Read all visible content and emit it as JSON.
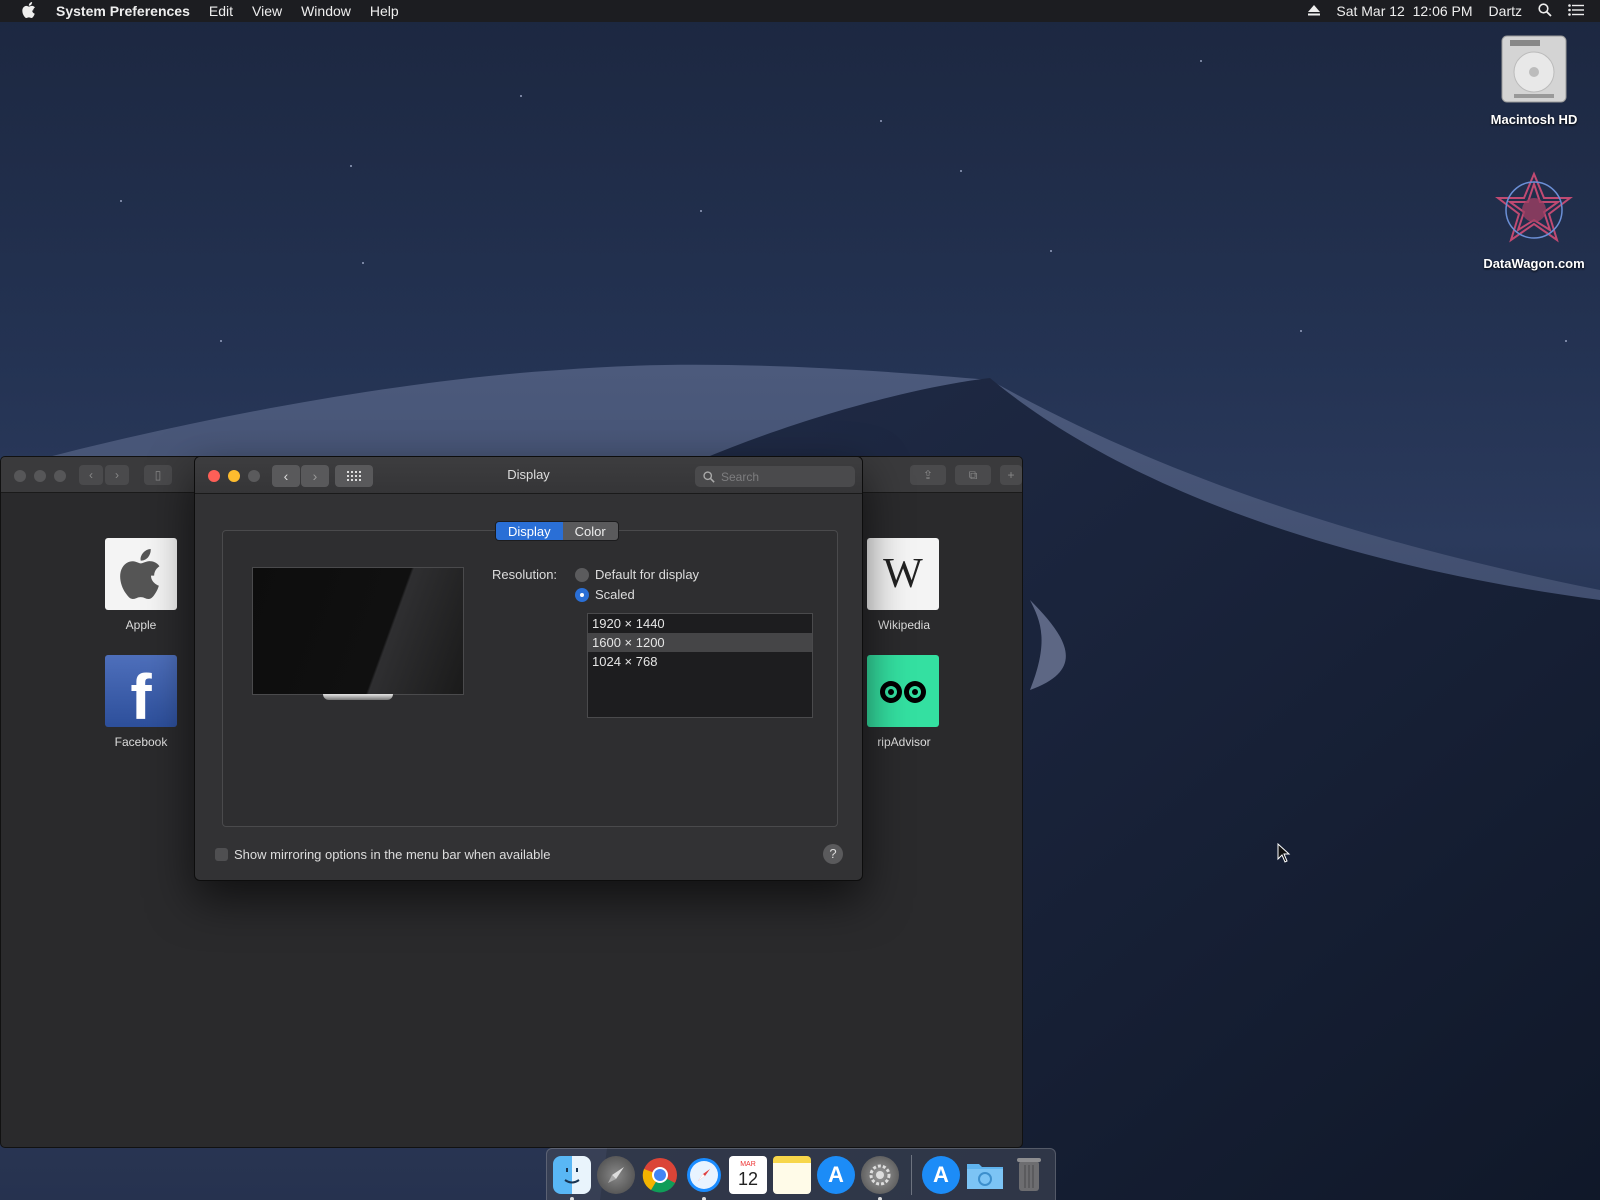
{
  "menubar": {
    "apple_icon": "apple-logo-icon",
    "app_name": "System Preferences",
    "menus": [
      "Edit",
      "View",
      "Window",
      "Help"
    ],
    "datetime": "Sat Mar 12  12:06 PM",
    "user": "Dartz",
    "icons": [
      "eject-icon",
      "spotlight-search-icon",
      "notification-center-icon"
    ]
  },
  "desktop": {
    "icons": [
      {
        "label": "Macintosh HD",
        "icon": "hard-drive-icon"
      },
      {
        "label": "DataWagon.com",
        "icon": "datawagon-logo-icon"
      }
    ]
  },
  "safari": {
    "favorites": [
      {
        "label": "Apple",
        "icon": "apple-icon"
      },
      {
        "label": "Facebook",
        "icon": "facebook-icon"
      },
      {
        "label": "Wikipedia",
        "icon": "wikipedia-icon"
      },
      {
        "label": "ripAdvisor",
        "icon": "tripadvisor-icon"
      }
    ]
  },
  "prefs": {
    "title": "Display",
    "search_placeholder": "Search",
    "tabs": [
      {
        "label": "Display",
        "active": true
      },
      {
        "label": "Color",
        "active": false
      }
    ],
    "resolution_label": "Resolution:",
    "options": [
      {
        "label": "Default for display",
        "selected": false
      },
      {
        "label": "Scaled",
        "selected": true
      }
    ],
    "resolutions": [
      {
        "label": "1920 × 1440",
        "selected": false
      },
      {
        "label": "1600 × 1200",
        "selected": true
      },
      {
        "label": "1024 × 768",
        "selected": false
      }
    ],
    "mirroring_label": "Show mirroring options in the menu bar when available",
    "mirroring_checked": false,
    "help_label": "?"
  },
  "dock": {
    "apps": [
      "finder-icon",
      "launchpad-icon",
      "chrome-icon",
      "safari-icon",
      "calendar-icon",
      "notes-icon",
      "app-store-icon",
      "system-preferences-icon"
    ],
    "calendar_month": "MAR",
    "calendar_day": "12",
    "extras": [
      "app-store-folder-icon",
      "downloads-folder-icon",
      "trash-icon"
    ]
  },
  "colors": {
    "accent": "#2a6fd6",
    "close": "#fe5f57",
    "minimize": "#febc2e"
  }
}
